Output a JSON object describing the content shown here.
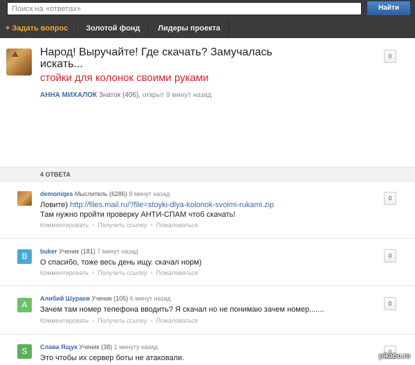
{
  "header": {
    "search_placeholder": "Поиск на «ответах»",
    "find_button": "Найти",
    "nav": {
      "ask": "+ Задать вопрос",
      "gold": "Золотой фонд",
      "leaders": "Лидеры проекта"
    }
  },
  "question": {
    "title": "Народ! Выручайте! Где скачать? Замучалась искать...",
    "subtitle": "стойки для колонок своими руками",
    "author": "АННА МИХАЛОК",
    "rank": "Знаток (406),",
    "time": "открыт 9 минут назад",
    "votes": "0"
  },
  "answers_header": "4 ОТВЕТА",
  "answers": [
    {
      "author": "demoniqes",
      "rank": "Мыслитель (6286)",
      "time": "8 минут назад",
      "line1_prefix": "Ловите)",
      "line1_link": "http://files.mail.ru/?file=stoyki-dlya-kolonok-svoimi-rukami.zip",
      "line2": "Там нужно пройти проверку АНТИ-СПАМ чтоб скачать!",
      "votes": "0",
      "initial": ""
    },
    {
      "author": "buker",
      "rank": "Ученик (181)",
      "time": "7 минут назад",
      "line1": "О спасибо, тоже весь день ищу. скачал норм)",
      "votes": "0",
      "initial": "B"
    },
    {
      "author": "Алибий Шураев",
      "rank": "Ученик (105)",
      "time": "6 минут назад",
      "line1": "Зачем там номер тепефона вводить? Я скачал но не понимаю зачем номер.......",
      "votes": "0",
      "initial": "A"
    },
    {
      "author": "Слава Ящук",
      "rank": "Ученик (38)",
      "time": "1 минуту назад",
      "line1": "Это чтобы их сервер боты не атаковали.",
      "votes": "0",
      "initial": "S"
    }
  ],
  "actions": {
    "comment": "Комментировать",
    "link": "Получить ссылку",
    "report": "Пожаловаться"
  },
  "watermark": "pikabu.ru",
  "colors": {
    "header_bg": "#3b3b3b",
    "accent_orange": "#f5a623",
    "author_blue": "#3a6aa9",
    "subtitle_red": "#d0242b",
    "avatar_b": "#4aa8d8",
    "avatar_a": "#6cc26c",
    "avatar_s": "#5cb05c"
  }
}
